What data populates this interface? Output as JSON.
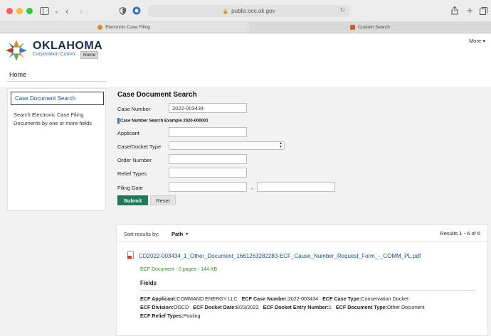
{
  "browser": {
    "url": "public.occ.ok.gov",
    "tabs": [
      {
        "label": "Electronic Case Filing"
      },
      {
        "label": "Custom Search"
      }
    ]
  },
  "header": {
    "brand": "OKLAHOMA",
    "brand_sub": "Corporation Comm",
    "tooltip": "Home",
    "more_label": "More ▾"
  },
  "breadcrumb": {
    "home": "Home"
  },
  "sidebar": {
    "active_item": "Case Document Search",
    "description": "Search Electronic Case Filing Documents by one or more fields"
  },
  "form": {
    "title": "Case Document Search",
    "case_number_label": "Case Number",
    "case_number_value": "2022-003434",
    "example_text": "Case Number Search Example 2020-000001",
    "applicant_label": "Applicant",
    "case_type_label": "Case/Docket Type",
    "order_number_label": "Order Number",
    "relief_types_label": "Relief Types",
    "filing_date_label": "Filing Date",
    "date_separator": "-",
    "submit_label": "Submit",
    "reset_label": "Reset"
  },
  "results": {
    "sort_label": "Sort results by:",
    "sort_value": "Path",
    "count_text": "Results  1 - 6 of 6",
    "items": [
      {
        "title": "CD2022-003434_1_Other_Document_1661263282283-ECF_Cause_Number_Request_Form_-_COMM_PL.pdf",
        "meta": "ECF Document - 0 pages - 144 KB",
        "fields_heading": "Fields",
        "fields": {
          "applicant_key": "ECF Applicant:",
          "applicant": "COMMAND ENERGY LLC",
          "case_number_key": "ECF Case Number:",
          "case_number": "2022-003434",
          "case_type_key": "ECF Case Type:",
          "case_type": "Conservation Docket",
          "division_key": "ECF Division:",
          "division": "OGCD",
          "docket_date_key": "ECF Docket Date:",
          "docket_date": "8/23/2022",
          "entry_number_key": "ECF Docket Entry Number:",
          "entry_number": "1",
          "doc_type_key": "ECF Document Type:",
          "doc_type": "Other Document",
          "relief_types_key": "ECF Relief Types:",
          "relief_types": "Pooling"
        }
      }
    ]
  },
  "colors": {
    "submit": "#1e7a5a",
    "link": "#1a4d8f",
    "meta_green": "#3a8a2c"
  }
}
